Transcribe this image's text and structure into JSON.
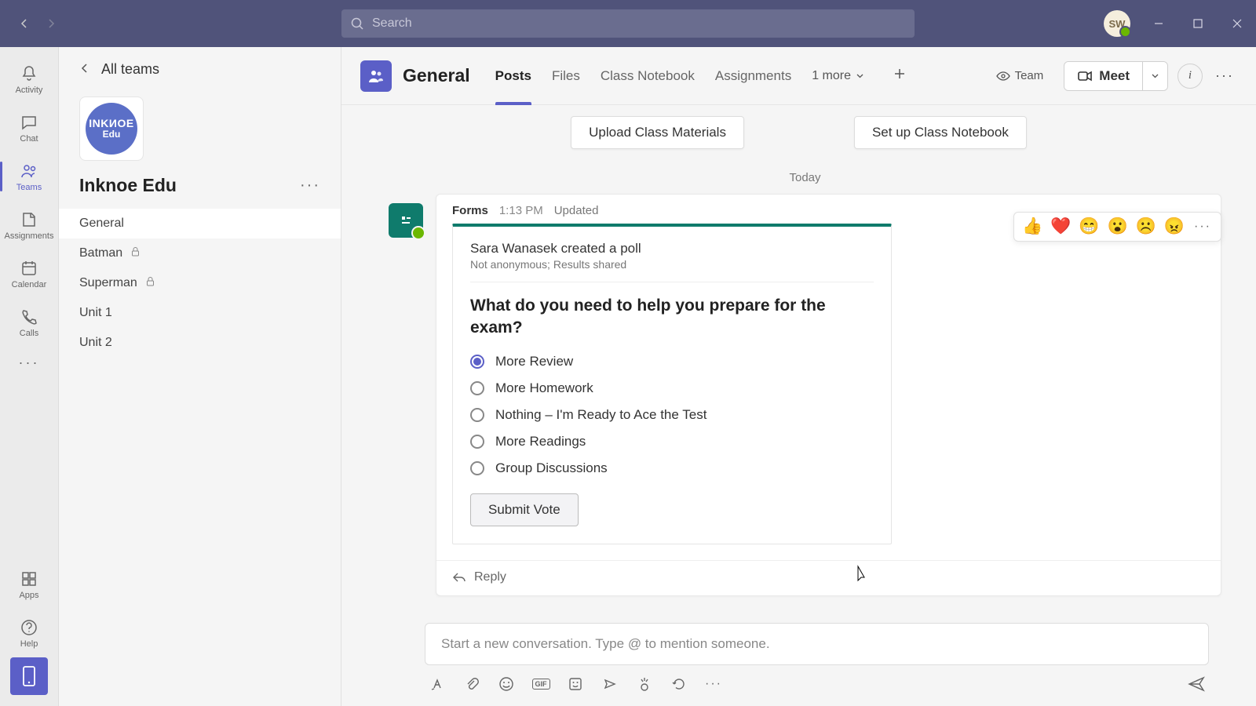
{
  "search": {
    "placeholder": "Search"
  },
  "avatar": {
    "initials": "SW"
  },
  "rail": {
    "activity": "Activity",
    "chat": "Chat",
    "teams": "Teams",
    "assignments": "Assignments",
    "calendar": "Calendar",
    "calls": "Calls",
    "apps": "Apps",
    "help": "Help"
  },
  "sidebar": {
    "back": "All teams",
    "team_badge_l1": "INKИOE",
    "team_badge_l2": "Edu",
    "team_name": "Inknoe Edu",
    "channels": [
      {
        "name": "General",
        "active": true,
        "locked": false
      },
      {
        "name": "Batman",
        "active": false,
        "locked": true
      },
      {
        "name": "Superman",
        "active": false,
        "locked": true
      },
      {
        "name": "Unit 1",
        "active": false,
        "locked": false
      },
      {
        "name": "Unit 2",
        "active": false,
        "locked": false
      }
    ]
  },
  "header": {
    "channel": "General",
    "tabs": {
      "posts": "Posts",
      "files": "Files",
      "notebook": "Class Notebook",
      "assignments": "Assignments",
      "more": "1 more"
    },
    "team_pill": "Team",
    "meet": "Meet"
  },
  "actions": {
    "upload": "Upload Class Materials",
    "setup": "Set up Class Notebook"
  },
  "date_separator": "Today",
  "reactions": [
    "👍",
    "❤️",
    "😁",
    "😮",
    "☹️",
    "😠"
  ],
  "post": {
    "app": "Forms",
    "time": "1:13 PM",
    "status": "Updated",
    "creator_line": "Sara Wanasek created a poll",
    "meta": "Not anonymous; Results shared",
    "question": "What do you need to help you prepare for the exam?",
    "options": [
      {
        "label": "More Review",
        "checked": true
      },
      {
        "label": "More Homework",
        "checked": false
      },
      {
        "label": "Nothing – I'm Ready to Ace the Test",
        "checked": false
      },
      {
        "label": "More Readings",
        "checked": false
      },
      {
        "label": "Group Discussions",
        "checked": false
      }
    ],
    "submit": "Submit Vote",
    "reply": "Reply"
  },
  "composer": {
    "placeholder": "Start a new conversation. Type @ to mention someone."
  }
}
